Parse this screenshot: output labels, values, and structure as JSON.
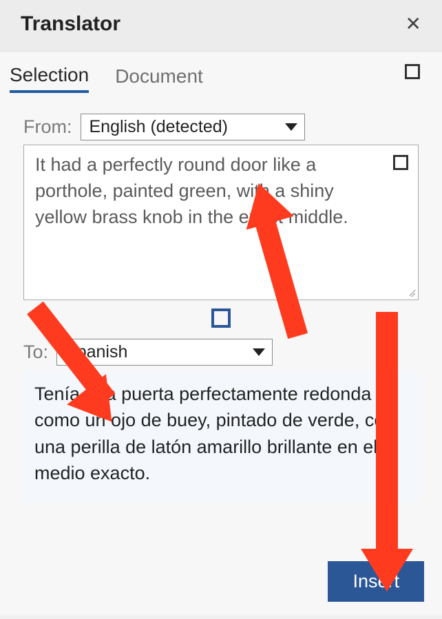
{
  "header": {
    "title": "Translator"
  },
  "tabs": {
    "selection": "Selection",
    "document": "Document"
  },
  "from": {
    "label": "From:",
    "selected": "English (detected)"
  },
  "source_text": "It had a perfectly round door like a porthole, painted green, with a shiny yellow brass knob in the exact middle.",
  "to": {
    "label": "To:",
    "selected": "Spanish"
  },
  "target_text": "Tenía una puerta perfectamente redonda como un ojo de buey, pintado de verde, con una perilla de latón amarillo brillante en el medio exacto.",
  "insert_label": "Insert"
}
